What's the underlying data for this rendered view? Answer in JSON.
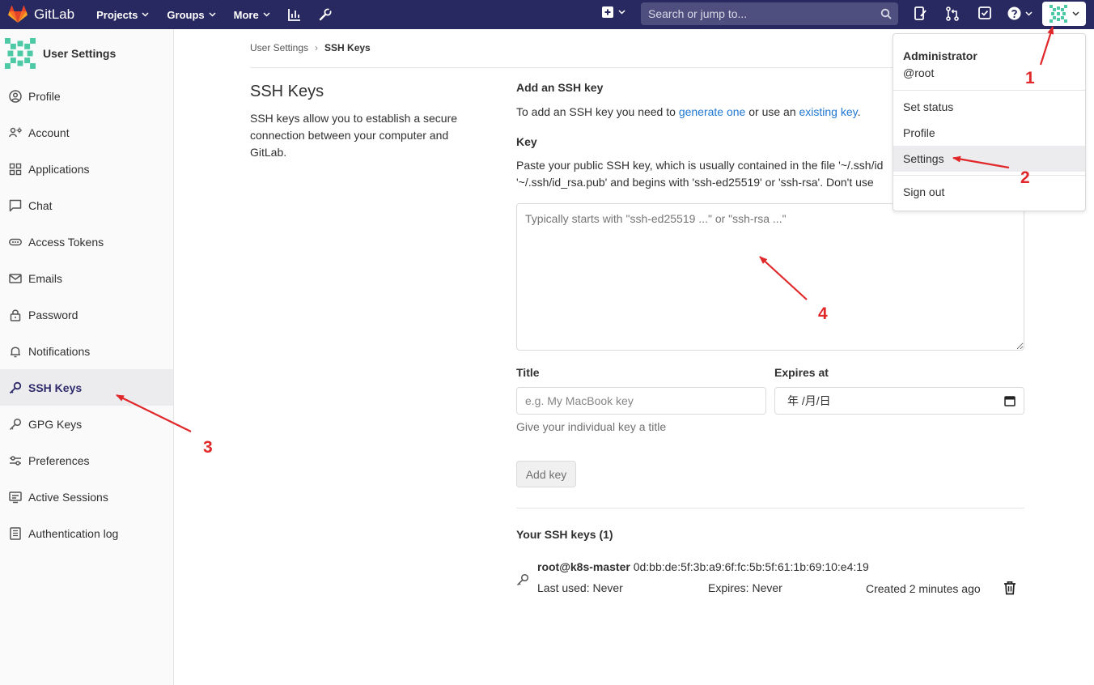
{
  "topbar": {
    "logo_text": "GitLab",
    "nav": [
      {
        "label": "Projects"
      },
      {
        "label": "Groups"
      },
      {
        "label": "More"
      }
    ],
    "search_placeholder": "Search or jump to..."
  },
  "sidebar": {
    "title": "User Settings",
    "items": [
      {
        "label": "Profile",
        "icon": "profile-icon"
      },
      {
        "label": "Account",
        "icon": "account-icon"
      },
      {
        "label": "Applications",
        "icon": "applications-icon"
      },
      {
        "label": "Chat",
        "icon": "chat-icon"
      },
      {
        "label": "Access Tokens",
        "icon": "token-icon"
      },
      {
        "label": "Emails",
        "icon": "mail-icon"
      },
      {
        "label": "Password",
        "icon": "lock-icon"
      },
      {
        "label": "Notifications",
        "icon": "bell-icon"
      },
      {
        "label": "SSH Keys",
        "icon": "key-icon"
      },
      {
        "label": "GPG Keys",
        "icon": "key-icon"
      },
      {
        "label": "Preferences",
        "icon": "preferences-icon"
      },
      {
        "label": "Active Sessions",
        "icon": "monitor-icon"
      },
      {
        "label": "Authentication log",
        "icon": "log-icon"
      }
    ]
  },
  "breadcrumb": {
    "parent": "User Settings",
    "current": "SSH Keys"
  },
  "intro": {
    "title": "SSH Keys",
    "description": "SSH keys allow you to establish a secure connection between your computer and GitLab."
  },
  "form": {
    "heading": "Add an SSH key",
    "help_prefix": "To add an SSH key you need to ",
    "help_link1": "generate one",
    "help_middle": " or use an ",
    "help_link2": "existing key",
    "help_suffix": ".",
    "key_label": "Key",
    "key_help_line1": "Paste your public SSH key, which is usually contained in the file '~/.ssh/id",
    "key_help_line2": "'~/.ssh/id_rsa.pub' and begins with 'ssh-ed25519' or 'ssh-rsa'. Don't use",
    "key_placeholder": "Typically starts with \"ssh-ed25519 ...\" or \"ssh-rsa ...\"",
    "title_label": "Title",
    "title_placeholder": "e.g. My MacBook key",
    "expires_label": "Expires at",
    "expires_value": "年 /月/日",
    "title_hint": "Give your individual key a title",
    "add_button": "Add key"
  },
  "keys": {
    "heading": "Your SSH keys (1)",
    "items": [
      {
        "name": "root@k8s-master",
        "fingerprint": "0d:bb:de:5f:3b:a9:6f:fc:5b:5f:61:1b:69:10:e4:19",
        "last_used": "Last used: Never",
        "expires": "Expires: Never",
        "created": "Created 2 minutes ago"
      }
    ]
  },
  "dropdown": {
    "name": "Administrator",
    "username": "@root",
    "items": [
      "Set status",
      "Profile",
      "Settings",
      "Sign out"
    ]
  },
  "annotations": [
    "1",
    "2",
    "3",
    "4"
  ],
  "colors": {
    "navbar": "#292961",
    "link": "#1f78d1",
    "annotation": "#e0282a",
    "active_item": "#2f2a6b"
  }
}
